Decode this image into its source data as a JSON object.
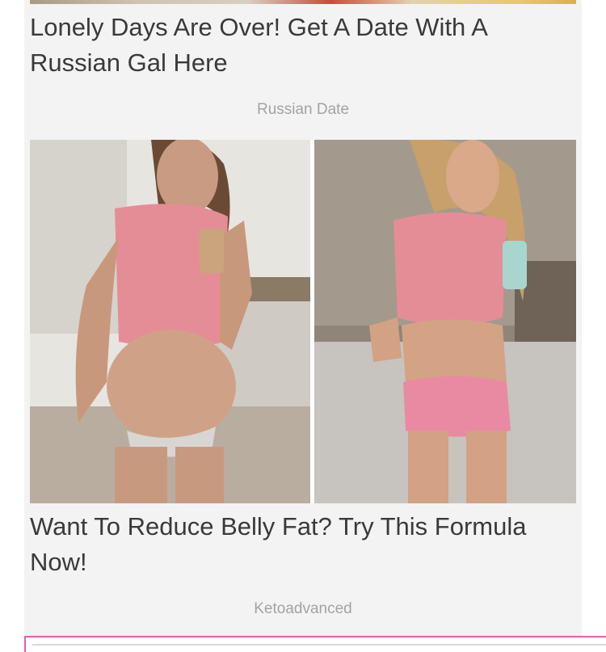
{
  "items": [
    {
      "headline": "Lonely Days Are Over! Get A Date With A Russian Gal Here",
      "source": "Russian Date",
      "image": "photo-thumbnail"
    },
    {
      "headline": "Want To Reduce Belly Fat? Try This Formula Now!",
      "source": "Ketoadvanced",
      "image": "before-after-weight-loss-photo"
    }
  ],
  "colors": {
    "feed_background": "#f3f3f3",
    "headline_text": "#3a3a3a",
    "source_text": "#a3a3a3",
    "highlight_border": "#e35fae"
  }
}
